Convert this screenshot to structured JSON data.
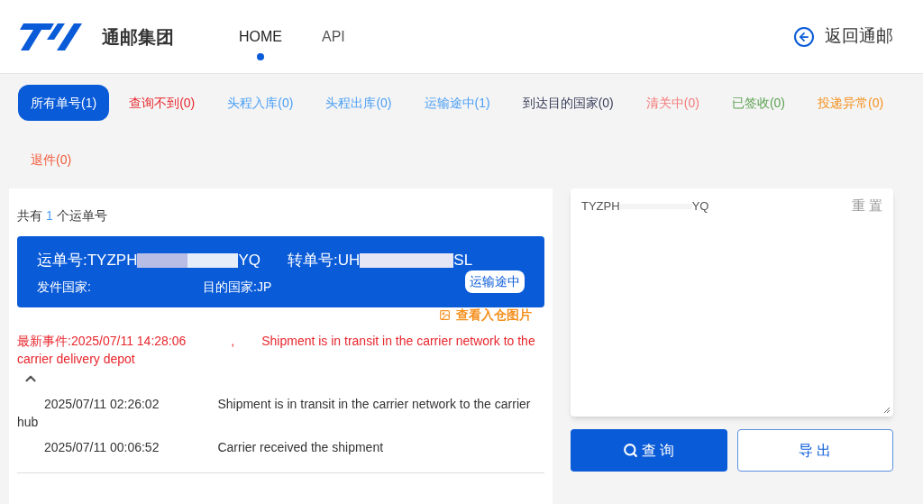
{
  "header": {
    "brand": "通邮集团",
    "nav": [
      {
        "label": "HOME",
        "selected": true
      },
      {
        "label": "API",
        "selected": false
      }
    ],
    "back_link": "返回通邮"
  },
  "filters": [
    {
      "label": "所有单号(1)",
      "selected": true
    },
    {
      "label": "查询不到(0)",
      "selected": false,
      "color": "#e8262d"
    },
    {
      "label": "头程入库(0)",
      "selected": false,
      "color": "#4a9ff5"
    },
    {
      "label": "头程出库(0)",
      "selected": false,
      "color": "#4a9ff5"
    },
    {
      "label": "运输途中(1)",
      "selected": false,
      "color": "#4a9ff5"
    },
    {
      "label": "到达目的国家(0)",
      "selected": false,
      "color": "#3a3f5c"
    },
    {
      "label": "清关中(0)",
      "selected": false,
      "color": "#f37a7a"
    },
    {
      "label": "已签收(0)",
      "selected": false,
      "color": "#5ca152"
    },
    {
      "label": "投递异常(0)",
      "selected": false,
      "color": "#f5901e"
    },
    {
      "label": "退件(0)",
      "selected": false,
      "color": "#f25a3a"
    }
  ],
  "results": {
    "count_prefix": "共有",
    "count": "1",
    "count_suffix": "个运单号",
    "shipment": {
      "tracking_label": "运单号:TYZPH",
      "tracking_suffix": "YQ",
      "transfer_label": "转单号:UH",
      "transfer_suffix": "SL",
      "origin_label": "发件国家:",
      "destination_label": "目的国家:",
      "destination": "JP",
      "status": "运输途中",
      "photo_link": "查看入仓图片"
    },
    "latest_event": {
      "label": "最新事件:",
      "time": "2025/07/11 14:28:06",
      "separator": ",",
      "text": "Shipment is in transit in the carrier network to the carrier delivery depot"
    },
    "expanded": true,
    "events": [
      {
        "time": "2025/07/11 02:26:02",
        "text": "Shipment is in transit in the carrier network to the carrier hub"
      },
      {
        "time": "2025/07/11 00:06:52",
        "text": "Carrier received the shipment"
      }
    ]
  },
  "query": {
    "value_prefix": "TYZPH",
    "value_suffix": "YQ",
    "reset": "重 置",
    "search_button": "查 询",
    "export_button": "导 出"
  }
}
